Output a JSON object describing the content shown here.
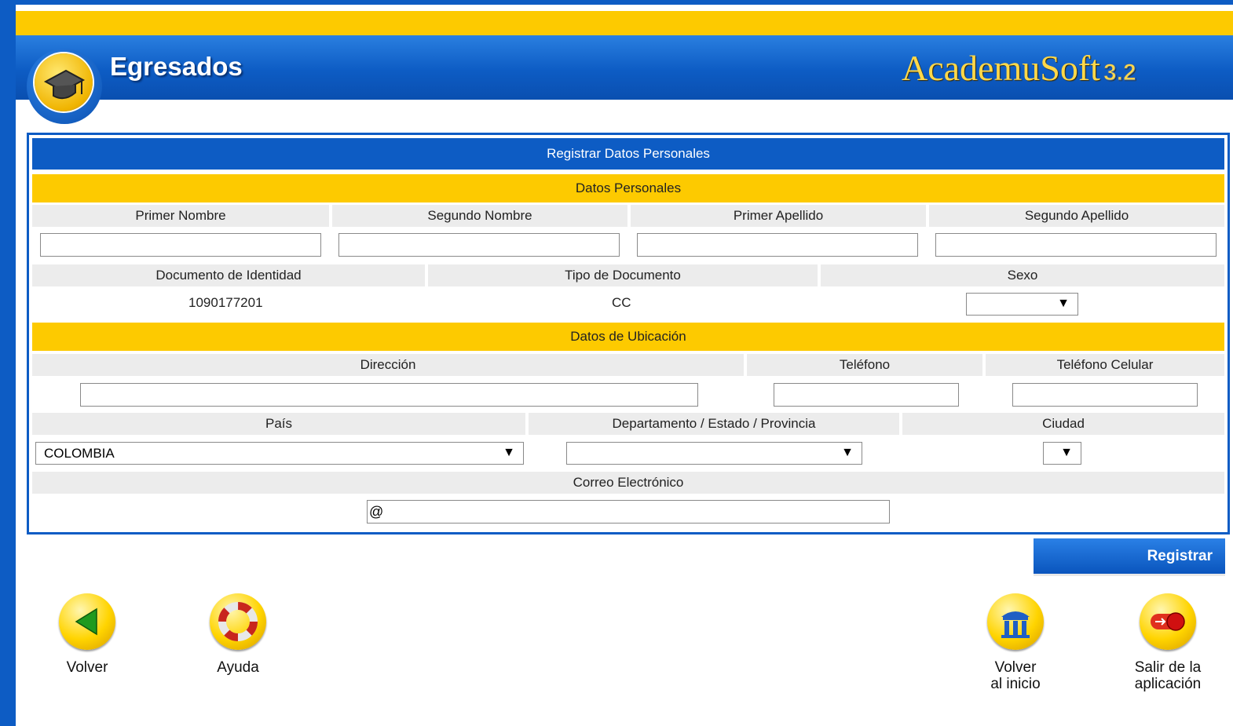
{
  "header": {
    "app_title": "Egresados",
    "brand": "AcademuSoft",
    "brand_version": "3.2"
  },
  "form": {
    "title": "Registrar Datos Personales",
    "section_personal": "Datos Personales",
    "labels_personal": {
      "primer_nombre": "Primer Nombre",
      "segundo_nombre": "Segundo Nombre",
      "primer_apellido": "Primer Apellido",
      "segundo_apellido": "Segundo Apellido",
      "documento": "Documento de Identidad",
      "tipo_documento": "Tipo de Documento",
      "sexo": "Sexo"
    },
    "values": {
      "primer_nombre": "",
      "segundo_nombre": "",
      "primer_apellido": "",
      "segundo_apellido": "",
      "documento": "1090177201",
      "tipo_documento": "CC",
      "sexo": "",
      "direccion": "",
      "telefono": "",
      "telefono_celular": "",
      "pais": "COLOMBIA",
      "departamento": "",
      "ciudad": "",
      "correo": "@"
    },
    "section_location": "Datos de Ubicación",
    "labels_location": {
      "direccion": "Dirección",
      "telefono": "Teléfono",
      "telefono_celular": "Teléfono Celular",
      "pais": "País",
      "departamento": "Departamento / Estado / Provincia",
      "ciudad": "Ciudad",
      "correo": "Correo Electrónico"
    },
    "submit_label": "Registrar"
  },
  "nav": {
    "volver": "Volver",
    "ayuda": "Ayuda",
    "volver_inicio_1": "Volver",
    "volver_inicio_2": "al inicio",
    "salir_1": "Salir de la",
    "salir_2": "aplicación"
  },
  "colors": {
    "primary_blue": "#0d5cc4",
    "accent_yellow": "#fdca00",
    "label_gray": "#ececec"
  }
}
